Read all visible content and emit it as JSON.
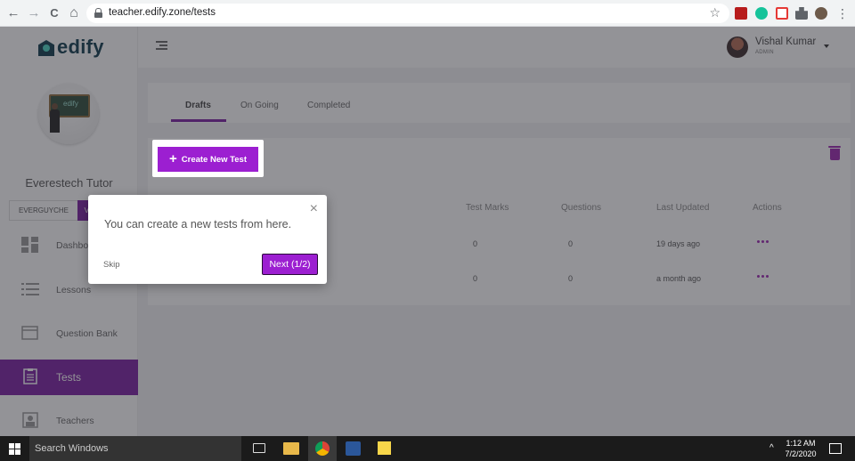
{
  "browser": {
    "url": "teacher.edify.zone/tests",
    "back": "←",
    "forward": "→",
    "reload": "C",
    "home": "⌂",
    "star": "☆",
    "menu": "⋮"
  },
  "sidebar": {
    "logo": "edify",
    "avatar_board_text": "edify",
    "tutor_name": "Everestech Tutor",
    "code": "EVERGUYCHE",
    "view_code_label": "View Code",
    "items": [
      {
        "label": "Dashboard",
        "icon": "dashboard-icon"
      },
      {
        "label": "Lessons",
        "icon": "list-icon"
      },
      {
        "label": "Question Bank",
        "icon": "folder-icon"
      },
      {
        "label": "Tests",
        "icon": "clipboard-icon"
      },
      {
        "label": "Teachers",
        "icon": "teacher-icon"
      }
    ]
  },
  "header": {
    "user_name": "Vishal Kumar",
    "user_role": "ADMIN"
  },
  "tabs": [
    {
      "label": "Drafts"
    },
    {
      "label": "On Going"
    },
    {
      "label": "Completed"
    }
  ],
  "actions": {
    "create_label": "Create New Test",
    "create_plus": "+"
  },
  "table": {
    "headers": [
      "Test Marks",
      "Questions",
      "Last Updated",
      "Actions"
    ],
    "rows": [
      {
        "marks": "0",
        "questions": "0",
        "updated": "19 days ago"
      },
      {
        "marks": "0",
        "questions": "0",
        "updated": "a month ago"
      }
    ]
  },
  "tour": {
    "message": "You can create a new tests from here.",
    "skip_label": "Skip",
    "next_label": "Next (1/2)",
    "close": "×"
  },
  "taskbar": {
    "search_placeholder": "Search Windows",
    "time": "1:12 AM",
    "date": "7/2/2020",
    "tray_caret": "^"
  },
  "colors": {
    "accent": "#7b1fa2",
    "button": "#9c1fd1"
  }
}
